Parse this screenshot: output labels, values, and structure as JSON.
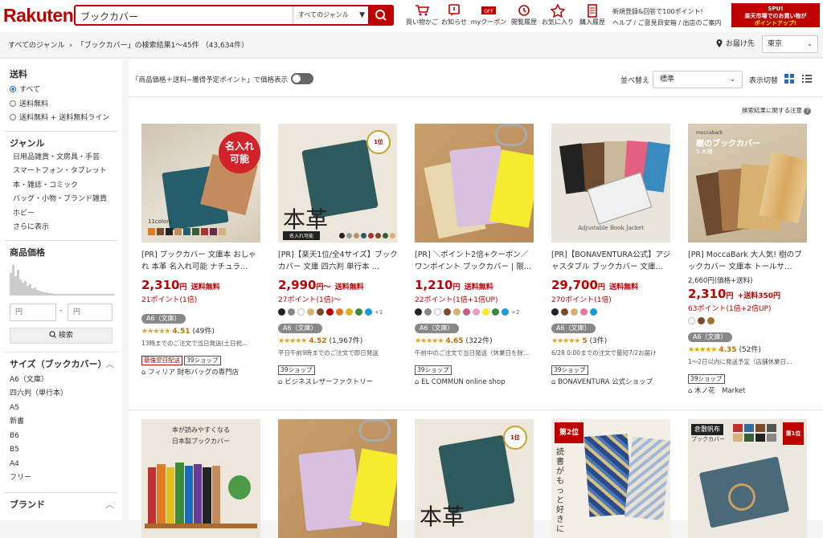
{
  "header": {
    "logo": "Rakuten",
    "search_value": "ブックカバー",
    "genre": "すべてのジャンル",
    "icons": [
      {
        "label": "買い物かご",
        "icon": "cart-icon"
      },
      {
        "label": "お知らせ",
        "icon": "notice-icon"
      },
      {
        "label": "myクーポン",
        "icon": "coupon-icon"
      },
      {
        "label": "閲覧履歴",
        "icon": "history-icon"
      },
      {
        "label": "お気に入り",
        "icon": "star-icon"
      },
      {
        "label": "購入履歴",
        "icon": "receipt-icon"
      }
    ],
    "links_line1": "新規登録&回答で100ポイント!",
    "links_line2": "ヘルプ / ご意見目安箱 / 出店のご案内",
    "spu_line1": "SPU!",
    "spu_line2": "楽天市場でのお買い物が",
    "spu_line3": "ポイントアップ!"
  },
  "breadcrumb": {
    "all": "すべてのジャンル",
    "result": "「ブックカバー」の検索結果1〜45件 （43,634件）",
    "deliver_label": "お届け先",
    "city": "東京"
  },
  "sidebar": {
    "shipping_title": "送料",
    "shipping": [
      {
        "label": "すべて",
        "on": true
      },
      {
        "label": "送料無料",
        "on": false
      },
      {
        "label": "送料無料 + 送料無料ライン",
        "on": false
      }
    ],
    "genre_title": "ジャンル",
    "genres": [
      "日用品雑貨・文房具・手芸",
      "スマートフォン・タブレット",
      "本・雑誌・コミック",
      "バッグ・小物・ブランド雑貨",
      "ホビー",
      "さらに表示"
    ],
    "price_title": "商品価格",
    "price_min_placeholder": "円",
    "price_max_placeholder": "円",
    "price_sep": "-",
    "search_btn": "検索",
    "size_title": "サイズ（ブックカバー）",
    "sizes": [
      "A6（文庫）",
      "四六判（単行本）",
      "A5",
      "新書",
      "B6",
      "B5",
      "A4",
      "フリー"
    ],
    "brand_title": "ブランド"
  },
  "toolbar": {
    "price_toggle": "「商品価格＋送料−獲得予定ポイント」で価格表示",
    "sort_label": "並べ替え",
    "sort_value": "標準",
    "view_label": "表示切替",
    "notice": "検索結果に関する注意"
  },
  "products": [
    {
      "title": "[PR] ブックカバー 文庫本 おしゃれ 本革 名入れ可能 ナチュラ…",
      "price": "2,310",
      "yen": "円",
      "ship": "送料無料",
      "pts": "21ポイント(1倍)",
      "size": "A6（文庫）",
      "stars": "★★★★★",
      "rating": "4.51",
      "reviews": "(49件)",
      "note": "13時までのご注文で当日発送(土日祝…",
      "tags": [
        "最強翌日配送",
        "39ショップ"
      ],
      "shop": "フィリア 財布バッグの専門店",
      "img_text": "名入れ\n可能",
      "img_sub": "11colors"
    },
    {
      "title": "[PR]【楽天1位/全4サイズ】ブックカバー 文庫 四六判 単行本 …",
      "price": "2,990",
      "yen": "円〜",
      "ship": "送料無料",
      "pts": "27ポイント(1倍)〜",
      "size": "A6（文庫）",
      "stars": "★★★★★",
      "rating": "4.52",
      "reviews": "(1,967件)",
      "note": "平日午前9時までのご注文で即日発送",
      "tags": [
        "39ショップ"
      ],
      "shop": "ビジネスレザーファクトリー",
      "img_text": "本革",
      "img_sub": "名入れ可能",
      "more": ""
    },
    {
      "title": "[PR] ＼ポイント2倍+クーポン／ワンポイント ブックカバー | 限…",
      "price": "1,210",
      "yen": "円",
      "ship": "送料無料",
      "pts": "22ポイント(1倍+1倍UP)",
      "size": "A6（文庫）",
      "stars": "★★★★★",
      "rating": "4.65",
      "reviews": "(322件)",
      "note": "午前中のご注文で当日発送（休業日を除…",
      "tags": [
        "39ショップ"
      ],
      "shop": "EL COMMUN online shop",
      "more": "+2"
    },
    {
      "title": "[PR]【BONAVENTURA公式】アジャスタブル ブックカバー 文庫…",
      "price": "29,700",
      "yen": "円",
      "ship": "送料無料",
      "pts": "270ポイント(1倍)",
      "size": "A6（文庫）",
      "stars": "★★★★★",
      "rating": "5",
      "reviews": "(3件)",
      "note": "6/28 0:00までの注文で最短7/2お届け",
      "tags": [
        "39ショップ"
      ],
      "shop": "BONAVENTURA 公式ショップ",
      "img_sub": "Adjustable Book Jacket"
    },
    {
      "title": "[PR] MoccaBark 大人気! 樹のブックカバー 文庫本 トールサ…",
      "price_alt": "2,660円(価格+送料)",
      "price": "2,310",
      "yen": "円",
      "ship": "+送料350円",
      "pts": "63ポイント(1倍+2倍UP)",
      "size": "A6（文庫）",
      "stars": "★★★★★",
      "rating": "4.35",
      "reviews": "(52件)",
      "note": "1〜2日以内に発送予定（店舗休業日…",
      "tags": [
        "39ショップ"
      ],
      "shop": "木ノ花　Market",
      "img_text": "樹のブックカバー",
      "img_sub": "5 木種"
    }
  ],
  "row2": {
    "p1_text": "本が読みやすくなる",
    "p1_text2": "日本製ブックカバー",
    "p3_text": "本革",
    "p4_text": "読書がもっと好きに",
    "p4_badge": "第2位",
    "p5_text": "倉敷帆布",
    "p5_sub": "ブックカバー",
    "p5_badge": "第1位"
  },
  "colors": {
    "red": "#bf0000",
    "accent_blue": "#2671b6"
  }
}
